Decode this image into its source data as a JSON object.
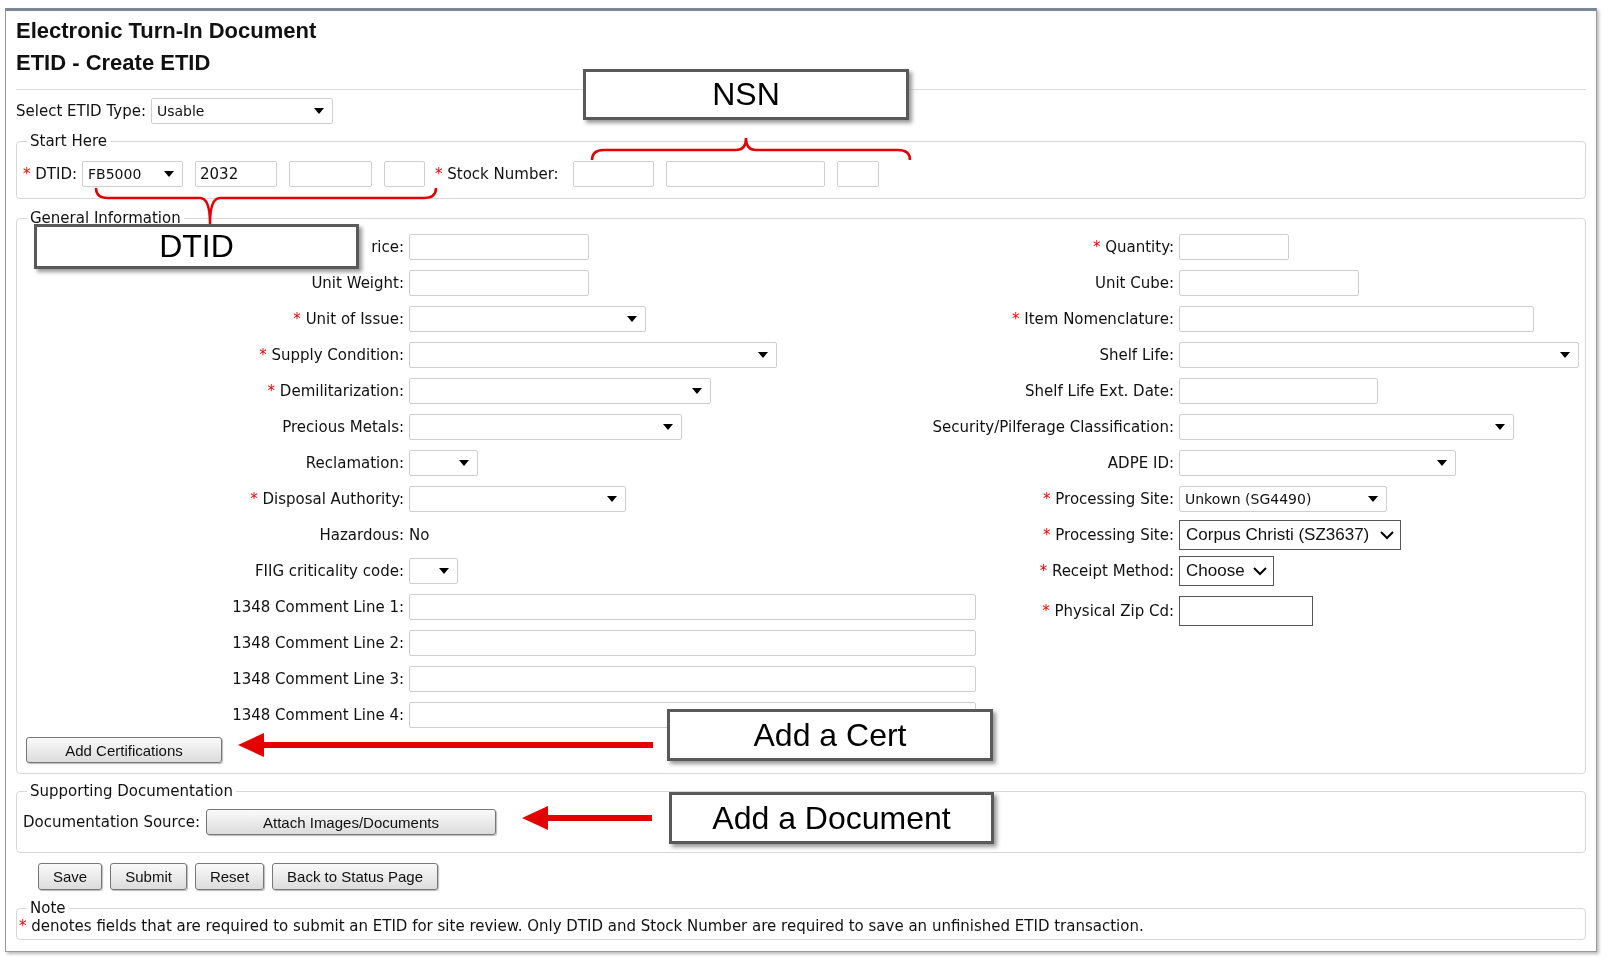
{
  "header": {
    "title": "Electronic Turn-In Document",
    "subtitle": "ETID - Create ETID"
  },
  "etid_type": {
    "label": "Select ETID Type:",
    "value": "Usable"
  },
  "start_here": {
    "legend": "Start Here",
    "dtid": {
      "mark": "*",
      "label": "DTID:",
      "code": "FB5000",
      "parts": [
        {
          "kind": "input",
          "value": "2032"
        },
        {
          "kind": "input"
        },
        {
          "kind": "input"
        }
      ]
    },
    "stock_number": {
      "mark": "*",
      "label": "Stock Number:",
      "parts": [
        {
          "kind": "input"
        },
        {
          "kind": "input"
        },
        {
          "kind": "input"
        }
      ]
    }
  },
  "general": {
    "legend": "General Information",
    "left": [
      {
        "label": "rice:",
        "kind": "input"
      },
      {
        "label": "Unit Weight:",
        "kind": "input"
      },
      {
        "mark": "*",
        "label": "Unit of Issue:",
        "kind": "select"
      },
      {
        "mark": "*",
        "label": "Supply Condition:",
        "kind": "select"
      },
      {
        "mark": "*",
        "label": "Demilitarization:",
        "kind": "select"
      },
      {
        "label": "Precious Metals:",
        "kind": "select"
      },
      {
        "label": "Reclamation:",
        "kind": "select"
      },
      {
        "mark": "*",
        "label": "Disposal Authority:",
        "kind": "select"
      },
      {
        "label": "Hazardous:",
        "kind": "text",
        "value": "No"
      },
      {
        "label": "FIIG criticality code:",
        "kind": "select"
      },
      {
        "label": "1348 Comment Line 1:",
        "kind": "input"
      },
      {
        "label": "1348 Comment Line 2:",
        "kind": "input"
      },
      {
        "label": "1348 Comment Line 3:",
        "kind": "input"
      },
      {
        "label": "1348 Comment Line 4:",
        "kind": "input"
      }
    ],
    "right": [
      {
        "mark": "*",
        "label": "Quantity:",
        "kind": "input"
      },
      {
        "label": "Unit Cube:",
        "kind": "input"
      },
      {
        "mark": "*",
        "label": "Item Nomenclature:",
        "kind": "input"
      },
      {
        "label": "Shelf Life:",
        "kind": "select"
      },
      {
        "label": "Shelf Life Ext. Date:",
        "kind": "input"
      },
      {
        "label": "Security/Pilferage Classification:",
        "kind": "select"
      },
      {
        "label": "ADPE ID:",
        "kind": "select"
      },
      {
        "mark": "*",
        "label": "Processing Site:",
        "kind": "select",
        "value": "Unkown (SG4490)"
      },
      {
        "mark": "*",
        "label": "Processing Site:",
        "kind": "classic_select",
        "value": "Corpus Christi (SZ3637)"
      },
      {
        "mark": "*",
        "label": "Receipt Method:",
        "kind": "classic_select",
        "value": "Choose"
      },
      {
        "mark": "*",
        "label": "Physical Zip Cd:",
        "kind": "classic_input"
      }
    ],
    "certifications_button": "Add Certifications"
  },
  "supporting": {
    "legend": "Supporting Documentation",
    "label": "Documentation Source:",
    "button": "Attach Images/Documents"
  },
  "actions": [
    "Save",
    "Submit",
    "Reset",
    "Back to Status Page"
  ],
  "note": {
    "legend": "Note",
    "mark": "*",
    "text": "denotes fields that are required to submit an ETID for site review. Only DTID and Stock Number are required to save an unfinished ETID transaction."
  },
  "annotations": [
    {
      "text": "NSN"
    },
    {
      "text": "DTID"
    },
    {
      "text": "Add a Cert"
    },
    {
      "text": "Add a Document"
    }
  ]
}
